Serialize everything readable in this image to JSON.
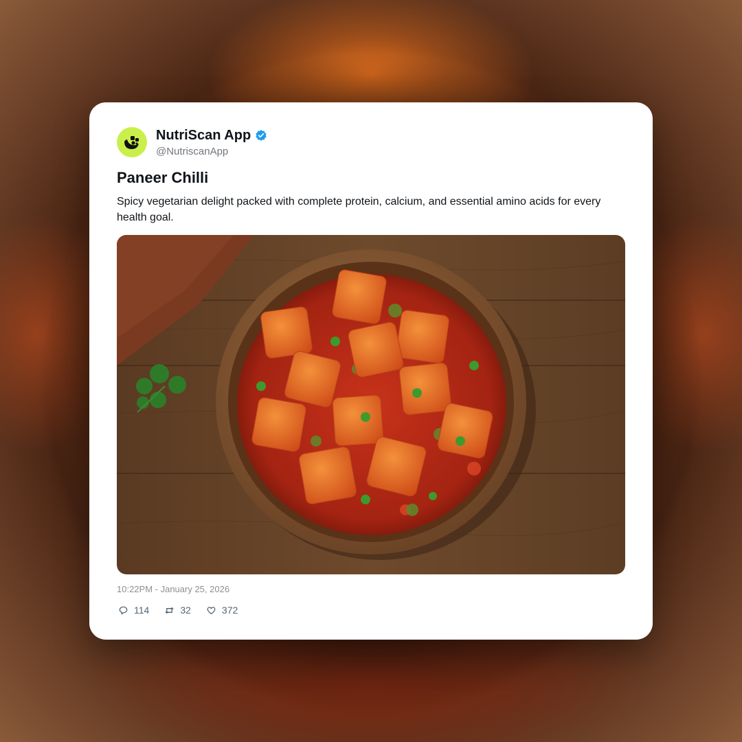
{
  "account": {
    "name": "NutriScan App",
    "handle": "@NutriscanApp",
    "avatar_icon": "nutriscan-logo-icon",
    "verified_icon": "verified-badge-icon",
    "avatar_color": "#c9f04a",
    "verified_color": "#1d9bf0"
  },
  "post": {
    "title": "Paneer Chilli",
    "description": "Spicy vegetarian delight packed with complete protein, calcium, and essential amino acids for every health goal.",
    "image_icon": "paneer-chilli-photo",
    "timestamp": "10:22PM - January 25, 2026"
  },
  "actions": {
    "replies": {
      "icon": "comment-icon",
      "count": "114"
    },
    "reposts": {
      "icon": "repost-icon",
      "count": "32"
    },
    "likes": {
      "icon": "heart-icon",
      "count": "372"
    }
  }
}
